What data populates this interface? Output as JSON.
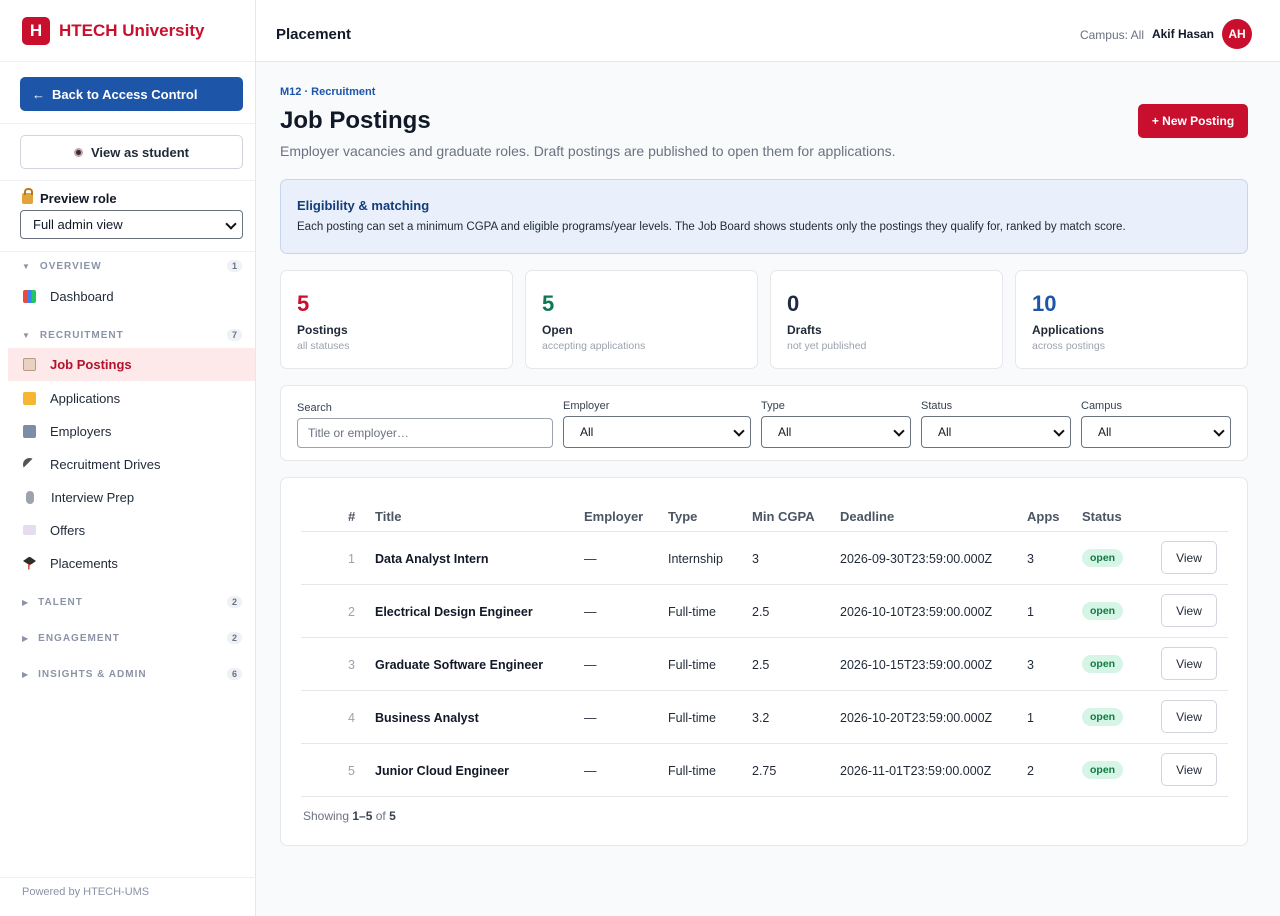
{
  "brand": {
    "logo_letter": "H",
    "name": "HTECH University",
    "color": "#c8102e"
  },
  "sidebar": {
    "back_button": "Back to Access Control",
    "back_arrow": "←",
    "view_student_button": "View as student",
    "preview_role_label": "Preview role",
    "role_select_value": "Full admin view",
    "sections": {
      "overview": {
        "label": "OVERVIEW",
        "count": "1"
      },
      "recruitment": {
        "label": "RECRUITMENT",
        "count": "7"
      },
      "talent": {
        "label": "TALENT",
        "count": "2"
      },
      "engagement": {
        "label": "ENGAGEMENT",
        "count": "2"
      },
      "insights": {
        "label": "INSIGHTS & ADMIN",
        "count": "6"
      }
    },
    "items": {
      "dashboard": "Dashboard",
      "job_postings": "Job Postings",
      "applications": "Applications",
      "employers": "Employers",
      "recruitment_drives": "Recruitment Drives",
      "interview_prep": "Interview Prep",
      "offers": "Offers",
      "placements": "Placements"
    },
    "powered_by": "Powered by HTECH-UMS"
  },
  "header": {
    "title": "Placement",
    "campus": "Campus: All",
    "user_name": "Akif Hasan",
    "avatar_initials": "AH"
  },
  "main": {
    "breadcrumb": "M12 · Recruitment",
    "title": "Job Postings",
    "subtitle": "Employer vacancies and graduate roles. Draft postings are published to open them for applications.",
    "new_button": "+ New Posting",
    "info": {
      "title": "Eligibility & matching",
      "text": "Each posting can set a minimum CGPA and eligible programs/year levels. The Job Board shows students only the postings they qualify for, ranked by match score."
    },
    "stats": [
      {
        "value": "5",
        "label": "Postings",
        "sub": "all statuses",
        "color": "#c8102e"
      },
      {
        "value": "5",
        "label": "Open",
        "sub": "accepting applications",
        "color": "#0f7a52"
      },
      {
        "value": "0",
        "label": "Drafts",
        "sub": "not yet published",
        "color": "#1f2a44"
      },
      {
        "value": "10",
        "label": "Applications",
        "sub": "across postings",
        "color": "#1d55a8"
      }
    ],
    "filters": {
      "search_label": "Search",
      "search_placeholder": "Title or employer…",
      "employer_label": "Employer",
      "employer_value": "All",
      "type_label": "Type",
      "type_value": "All",
      "status_label": "Status",
      "status_value": "All",
      "campus_label": "Campus",
      "campus_value": "All"
    },
    "table": {
      "headers": [
        "#",
        "Title",
        "Employer",
        "Type",
        "Min CGPA",
        "Deadline",
        "Apps",
        "Status"
      ],
      "rows": [
        {
          "num": "1",
          "title": "Data Analyst Intern",
          "employer": "—",
          "type": "Internship",
          "cgpa": "3",
          "deadline": "2026-09-30T23:59:00.000Z",
          "apps": "3",
          "status": "open",
          "action": "View"
        },
        {
          "num": "2",
          "title": "Electrical Design Engineer",
          "employer": "—",
          "type": "Full-time",
          "cgpa": "2.5",
          "deadline": "2026-10-10T23:59:00.000Z",
          "apps": "1",
          "status": "open",
          "action": "View"
        },
        {
          "num": "3",
          "title": "Graduate Software Engineer",
          "employer": "—",
          "type": "Full-time",
          "cgpa": "2.5",
          "deadline": "2026-10-15T23:59:00.000Z",
          "apps": "3",
          "status": "open",
          "action": "View"
        },
        {
          "num": "4",
          "title": "Business Analyst",
          "employer": "—",
          "type": "Full-time",
          "cgpa": "3.2",
          "deadline": "2026-10-20T23:59:00.000Z",
          "apps": "1",
          "status": "open",
          "action": "View"
        },
        {
          "num": "5",
          "title": "Junior Cloud Engineer",
          "employer": "—",
          "type": "Full-time",
          "cgpa": "2.75",
          "deadline": "2026-11-01T23:59:00.000Z",
          "apps": "2",
          "status": "open",
          "action": "View"
        }
      ],
      "showing_prefix": "Showing",
      "showing_range": "1–5",
      "showing_of": "of",
      "showing_total": "5"
    }
  }
}
